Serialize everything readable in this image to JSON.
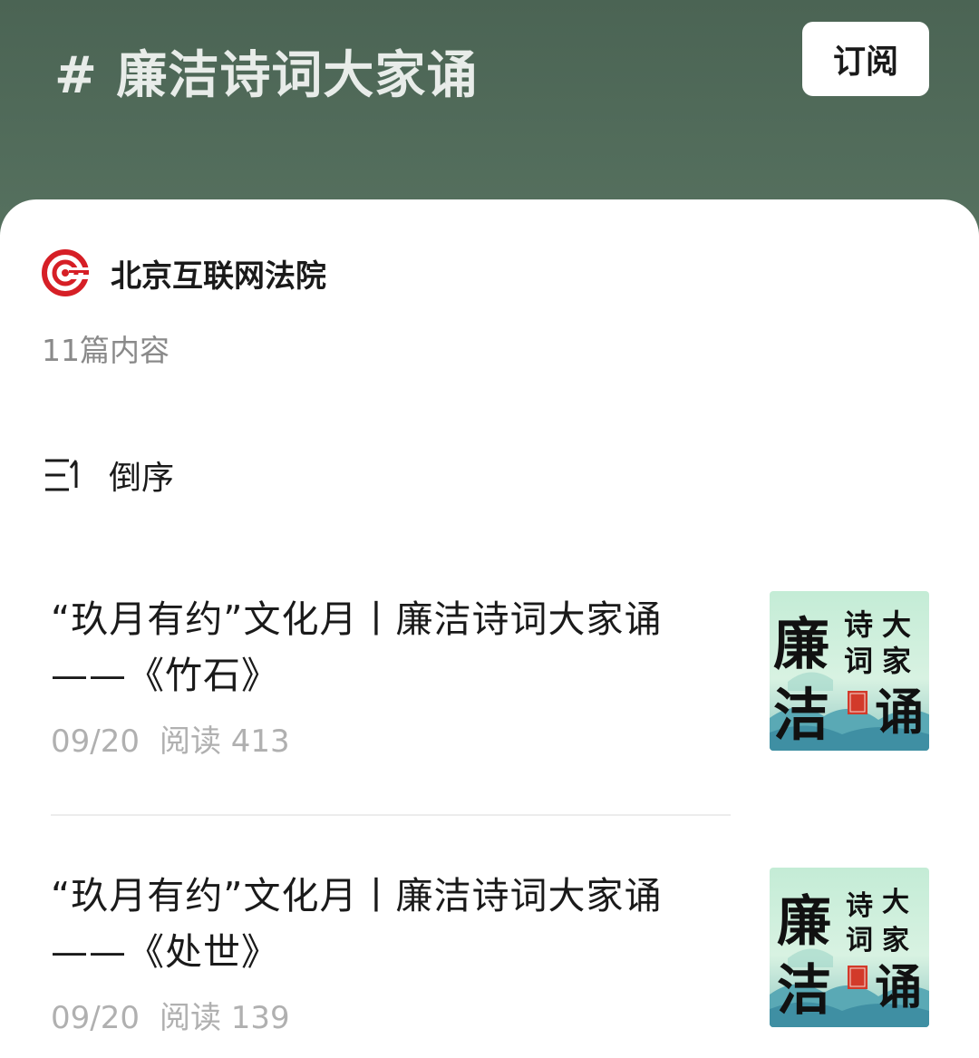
{
  "header": {
    "title": "# 廉洁诗词大家诵",
    "subscribe_label": "订阅"
  },
  "account": {
    "name": "北京互联网法院",
    "content_count": "11篇内容"
  },
  "sort": {
    "label": "倒序"
  },
  "articles": [
    {
      "title_line1": "“玖月有约”文化月丨廉洁诗词大家诵",
      "title_line2": "——《竹石》",
      "date": "09/20",
      "read_label": "阅读",
      "read_count": "413",
      "thumbnail": {
        "big_chars": [
          "廉",
          "洁"
        ],
        "small_chars": [
          "诗",
          "大",
          "词",
          "家"
        ],
        "big_char_right": "诵",
        "seal_text": "云动莲井"
      }
    },
    {
      "title_line1": "“玖月有约”文化月丨廉洁诗词大家诵",
      "title_line2": "——《处世》",
      "date": "09/20",
      "read_label": "阅读",
      "read_count": "139",
      "thumbnail": {
        "big_chars": [
          "廉",
          "洁"
        ],
        "small_chars": [
          "诗",
          "大",
          "词",
          "家"
        ],
        "big_char_right": "诵",
        "seal_text": "云动莲井"
      }
    }
  ],
  "colors": {
    "header_bg": "#4e6858",
    "logo_red": "#d61f26",
    "meta_gray": "#b0b0b0"
  }
}
